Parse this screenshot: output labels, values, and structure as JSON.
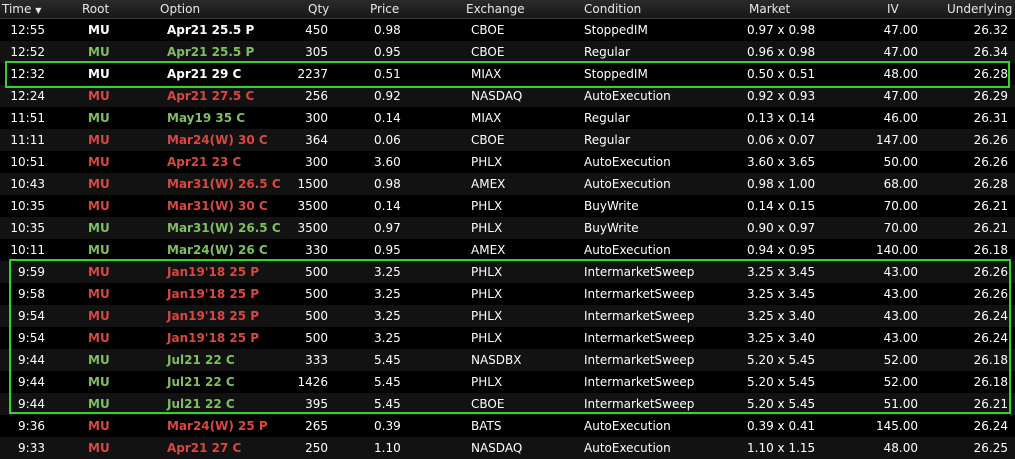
{
  "columns": {
    "time": "Time",
    "sort_indicator": "▼",
    "root": "Root",
    "option": "Option",
    "qty": "Qty",
    "price": "Price",
    "exchange": "Exchange",
    "condition": "Condition",
    "market": "Market",
    "iv": "IV",
    "underlying": "Underlying"
  },
  "colors": {
    "red": "#d9473f",
    "green": "#7fbf5e",
    "white": "#ffffff",
    "highlight_border": "#32d42a"
  },
  "rows": [
    {
      "time": "12:55",
      "root": "MU",
      "option": "Apr21 25.5 P",
      "qty": "450",
      "price": "0.98",
      "exchange": "CBOE",
      "condition": "StoppedIM",
      "market": "0.97 x 0.98",
      "iv": "47.00",
      "underlying": "26.32",
      "color": "white"
    },
    {
      "time": "12:52",
      "root": "MU",
      "option": "Apr21 25.5 P",
      "qty": "305",
      "price": "0.95",
      "exchange": "CBOE",
      "condition": "Regular",
      "market": "0.96 x 0.98",
      "iv": "47.00",
      "underlying": "26.34",
      "color": "green"
    },
    {
      "time": "12:32",
      "root": "MU",
      "option": "Apr21 29 C",
      "qty": "2237",
      "price": "0.51",
      "exchange": "MIAX",
      "condition": "StoppedIM",
      "market": "0.50 x 0.51",
      "iv": "48.00",
      "underlying": "26.28",
      "color": "white"
    },
    {
      "time": "12:24",
      "root": "MU",
      "option": "Apr21 27.5 C",
      "qty": "256",
      "price": "0.92",
      "exchange": "NASDAQ",
      "condition": "AutoExecution",
      "market": "0.92 x 0.93",
      "iv": "47.00",
      "underlying": "26.29",
      "color": "red"
    },
    {
      "time": "11:51",
      "root": "MU",
      "option": "May19 35 C",
      "qty": "300",
      "price": "0.14",
      "exchange": "MIAX",
      "condition": "Regular",
      "market": "0.13 x 0.14",
      "iv": "46.00",
      "underlying": "26.31",
      "color": "green"
    },
    {
      "time": "11:11",
      "root": "MU",
      "option": "Mar24(W) 30 C",
      "qty": "364",
      "price": "0.06",
      "exchange": "CBOE",
      "condition": "Regular",
      "market": "0.06 x 0.07",
      "iv": "147.00",
      "underlying": "26.26",
      "color": "red"
    },
    {
      "time": "10:51",
      "root": "MU",
      "option": "Apr21 23 C",
      "qty": "300",
      "price": "3.60",
      "exchange": "PHLX",
      "condition": "AutoExecution",
      "market": "3.60 x 3.65",
      "iv": "50.00",
      "underlying": "26.26",
      "color": "red"
    },
    {
      "time": "10:43",
      "root": "MU",
      "option": "Mar31(W) 26.5 C",
      "qty": "1500",
      "price": "0.98",
      "exchange": "AMEX",
      "condition": "AutoExecution",
      "market": "0.98 x 1.00",
      "iv": "68.00",
      "underlying": "26.28",
      "color": "red"
    },
    {
      "time": "10:35",
      "root": "MU",
      "option": "Mar31(W) 30 C",
      "qty": "3500",
      "price": "0.14",
      "exchange": "PHLX",
      "condition": "BuyWrite",
      "market": "0.14 x 0.15",
      "iv": "70.00",
      "underlying": "26.21",
      "color": "red"
    },
    {
      "time": "10:35",
      "root": "MU",
      "option": "Mar31(W) 26.5 C",
      "qty": "3500",
      "price": "0.97",
      "exchange": "PHLX",
      "condition": "BuyWrite",
      "market": "0.90 x 0.97",
      "iv": "70.00",
      "underlying": "26.21",
      "color": "green"
    },
    {
      "time": "10:11",
      "root": "MU",
      "option": "Mar24(W) 26 C",
      "qty": "330",
      "price": "0.95",
      "exchange": "AMEX",
      "condition": "AutoExecution",
      "market": "0.94 x 0.95",
      "iv": "140.00",
      "underlying": "26.18",
      "color": "green"
    },
    {
      "time": "9:59",
      "root": "MU",
      "option": "Jan19'18 25 P",
      "qty": "500",
      "price": "3.25",
      "exchange": "PHLX",
      "condition": "IntermarketSweep",
      "market": "3.25 x 3.45",
      "iv": "43.00",
      "underlying": "26.26",
      "color": "red"
    },
    {
      "time": "9:58",
      "root": "MU",
      "option": "Jan19'18 25 P",
      "qty": "500",
      "price": "3.25",
      "exchange": "PHLX",
      "condition": "IntermarketSweep",
      "market": "3.25 x 3.45",
      "iv": "43.00",
      "underlying": "26.26",
      "color": "red"
    },
    {
      "time": "9:54",
      "root": "MU",
      "option": "Jan19'18 25 P",
      "qty": "500",
      "price": "3.25",
      "exchange": "PHLX",
      "condition": "IntermarketSweep",
      "market": "3.25 x 3.40",
      "iv": "43.00",
      "underlying": "26.24",
      "color": "red"
    },
    {
      "time": "9:54",
      "root": "MU",
      "option": "Jan19'18 25 P",
      "qty": "500",
      "price": "3.25",
      "exchange": "PHLX",
      "condition": "IntermarketSweep",
      "market": "3.25 x 3.40",
      "iv": "43.00",
      "underlying": "26.24",
      "color": "red"
    },
    {
      "time": "9:44",
      "root": "MU",
      "option": "Jul21 22 C",
      "qty": "333",
      "price": "5.45",
      "exchange": "NASDBX",
      "condition": "IntermarketSweep",
      "market": "5.20 x 5.45",
      "iv": "52.00",
      "underlying": "26.18",
      "color": "green"
    },
    {
      "time": "9:44",
      "root": "MU",
      "option": "Jul21 22 C",
      "qty": "1426",
      "price": "5.45",
      "exchange": "PHLX",
      "condition": "IntermarketSweep",
      "market": "5.20 x 5.45",
      "iv": "52.00",
      "underlying": "26.18",
      "color": "green"
    },
    {
      "time": "9:44",
      "root": "MU",
      "option": "Jul21 22 C",
      "qty": "395",
      "price": "5.45",
      "exchange": "CBOE",
      "condition": "IntermarketSweep",
      "market": "5.20 x 5.45",
      "iv": "51.00",
      "underlying": "26.21",
      "color": "green"
    },
    {
      "time": "9:36",
      "root": "MU",
      "option": "Mar24(W) 25 P",
      "qty": "265",
      "price": "0.39",
      "exchange": "BATS",
      "condition": "AutoExecution",
      "market": "0.39 x 0.41",
      "iv": "145.00",
      "underlying": "26.24",
      "color": "red"
    },
    {
      "time": "9:33",
      "root": "MU",
      "option": "Apr21 27 C",
      "qty": "250",
      "price": "1.10",
      "exchange": "NASDAQ",
      "condition": "AutoExecution",
      "market": "1.10 x 1.15",
      "iv": "48.00",
      "underlying": "26.25",
      "color": "red"
    }
  ]
}
